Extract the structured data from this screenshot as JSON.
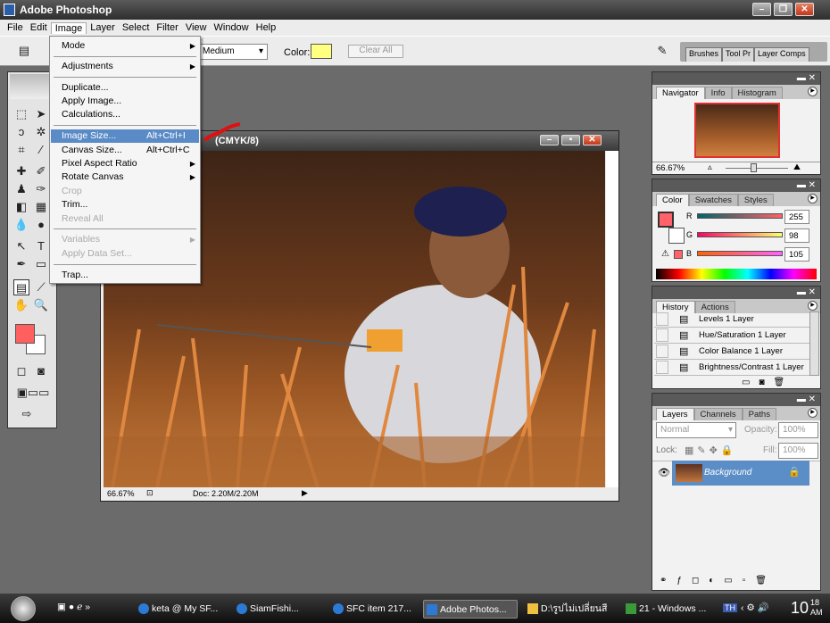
{
  "app": {
    "title": "Adobe Photoshop"
  },
  "menubar": [
    "File",
    "Edit",
    "Image",
    "Layer",
    "Select",
    "Filter",
    "View",
    "Window",
    "Help"
  ],
  "options": {
    "style_value": "Medium",
    "color_label": "Color:",
    "color": "#ffff80",
    "clear_all": "Clear All",
    "palette_tabs": [
      "Brushes",
      "Tool Pr",
      "Layer Comps"
    ]
  },
  "image_menu": {
    "items": [
      {
        "label": "Mode",
        "submenu": true
      },
      {
        "label": "Adjustments",
        "submenu": true
      },
      {
        "label": "Duplicate..."
      },
      {
        "label": "Apply Image..."
      },
      {
        "label": "Calculations..."
      },
      {
        "label": "Image Size...",
        "shortcut": "Alt+Ctrl+I",
        "highlighted": true
      },
      {
        "label": "Canvas Size...",
        "shortcut": "Alt+Ctrl+C"
      },
      {
        "label": "Pixel Aspect Ratio",
        "submenu": true
      },
      {
        "label": "Rotate Canvas",
        "submenu": true
      },
      {
        "label": "Crop",
        "disabled": true
      },
      {
        "label": "Trim..."
      },
      {
        "label": "Reveal All",
        "disabled": true
      },
      {
        "label": "Variables",
        "submenu": true,
        "disabled": true
      },
      {
        "label": "Apply Data Set...",
        "disabled": true
      },
      {
        "label": "Trap..."
      }
    ]
  },
  "document": {
    "title": "(CMYK/8)",
    "zoom": "66.67%",
    "doc_size": "Doc: 2.20M/2.20M"
  },
  "toolbox": {
    "foreground": "#ff5f5f",
    "background": "#ffffff"
  },
  "navigator": {
    "tabs": [
      "Navigator",
      "Info",
      "Histogram"
    ],
    "zoom": "66.67%"
  },
  "color": {
    "tabs": [
      "Color",
      "Swatches",
      "Styles"
    ],
    "channels": [
      {
        "label": "R",
        "value": "255"
      },
      {
        "label": "G",
        "value": "98"
      },
      {
        "label": "B",
        "value": "105"
      }
    ],
    "swatch": "#ff6269"
  },
  "history": {
    "tabs": [
      "History",
      "Actions"
    ],
    "items": [
      "Levels 1 Layer",
      "Hue/Saturation 1 Layer",
      "Color Balance 1 Layer",
      "Brightness/Contrast 1 Layer"
    ]
  },
  "layers": {
    "tabs": [
      "Layers",
      "Channels",
      "Paths"
    ],
    "blend_mode": "Normal",
    "opacity_label": "Opacity:",
    "opacity": "100%",
    "lock_label": "Lock:",
    "fill_label": "Fill:",
    "fill": "100%",
    "layer_name": "Background"
  },
  "taskbar": {
    "items": [
      "keta @ My SF...",
      "SiamFishi...",
      "SFC item 217...",
      "Adobe Photos...",
      "D:\\รูปไม่เปลี่ยนสี",
      "21 - Windows ..."
    ],
    "language": "TH",
    "time": "10",
    "time_small": "18",
    "ampm": "AM"
  }
}
